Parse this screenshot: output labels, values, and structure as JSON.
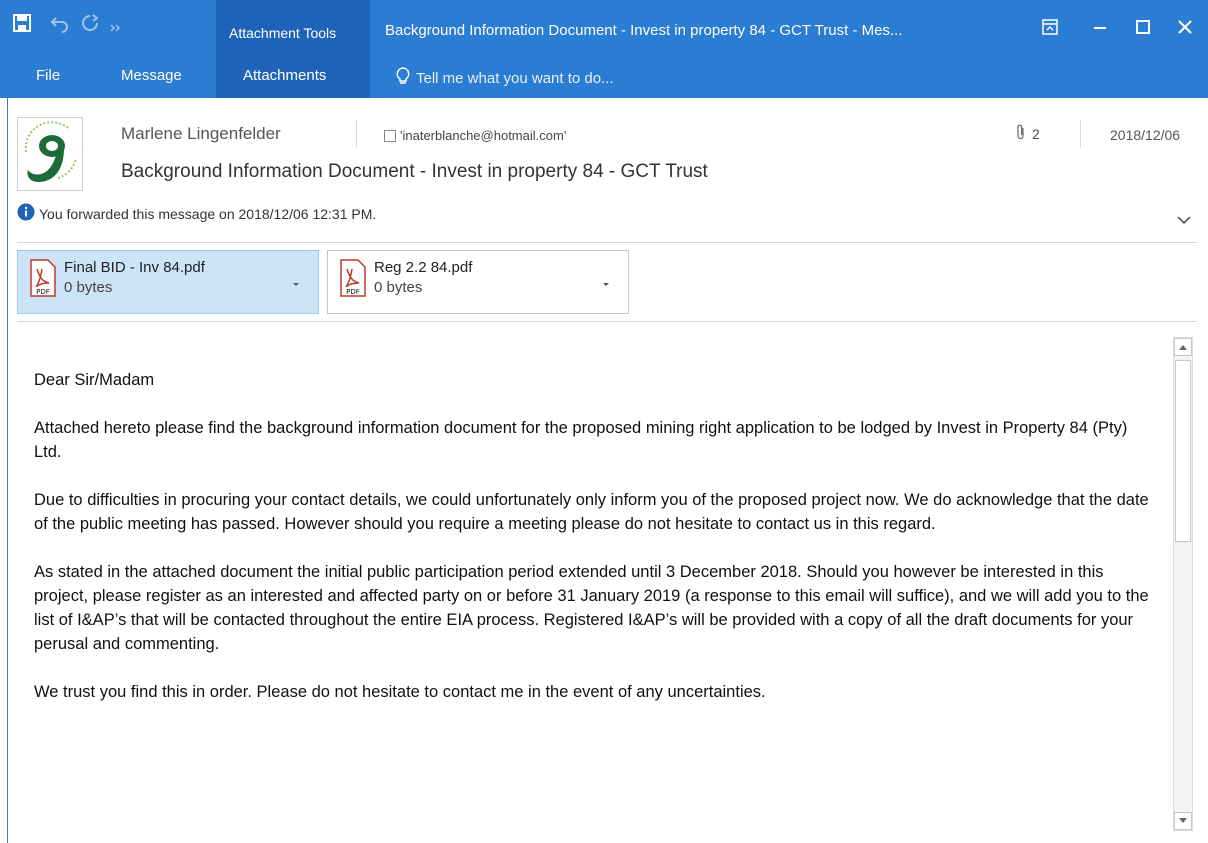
{
  "window": {
    "title": "Background Information Document - Invest in property 84 - GCT Trust - Mes...",
    "context_group": "Attachment Tools"
  },
  "ribbon": {
    "tabs": [
      "File",
      "Message",
      "Attachments"
    ],
    "tell_me": "Tell me what you want to do..."
  },
  "header": {
    "sender": "Marlene Lingenfelder",
    "recipient": "'inaterblanche@hotmail.com'",
    "attachment_count": "2",
    "date": "2018/12/06",
    "subject": "Background Information Document - Invest in property 84 - GCT Trust",
    "info": "You forwarded this message on 2018/12/06 12:31 PM."
  },
  "attachments": [
    {
      "name": "Final BID - Inv 84.pdf",
      "size": "0 bytes",
      "icon": "pdf-icon"
    },
    {
      "name": "Reg 2.2 84.pdf",
      "size": "0 bytes",
      "icon": "pdf-icon"
    }
  ],
  "body": {
    "greeting": "Dear Sir/Madam",
    "p1": "Attached hereto please find the background information document for the proposed mining right application to be lodged by Invest in Property 84 (Pty) Ltd.",
    "p2": "Due to difficulties in procuring your contact details, we could unfortunately only inform you of the proposed project now.  We do acknowledge that the date of the public meeting has passed.  However should you require a meeting please do not hesitate to contact us in this regard.",
    "p3": "As stated in the attached document the initial public participation period extended until 3 December 2018.  Should you however be interested in this project, please register as an interested and affected party on or before 31 January 2019 (a response to this email will suffice), and we will add you to the list of I&AP’s that will be contacted throughout the entire EIA process.  Registered I&AP’s will be provided with a copy of all the draft documents for your perusal and commenting.",
    "p4": "We trust you find this in order.  Please do not hesitate to contact me in the event of any uncertainties."
  },
  "colors": {
    "ribbon": "#2b7cd3",
    "context_tab": "#1e63b8",
    "selected_attachment": "#cce4f7"
  }
}
